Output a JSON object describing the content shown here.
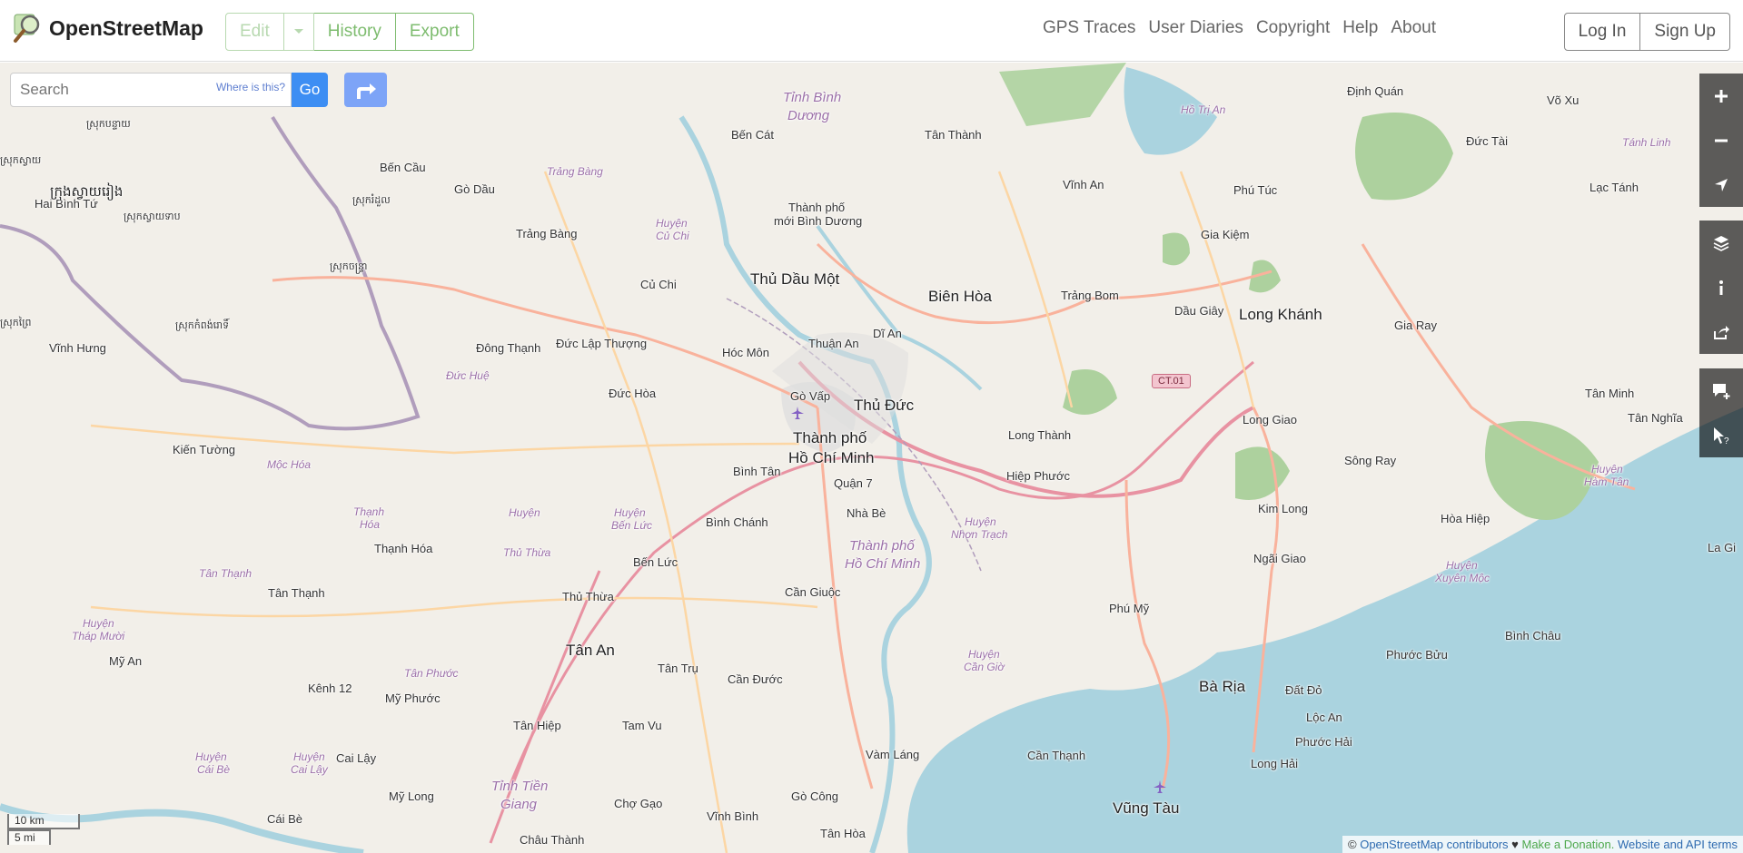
{
  "header": {
    "site_name": "OpenStreetMap",
    "edit_label": "Edit",
    "history_label": "History",
    "export_label": "Export",
    "nav": [
      "GPS Traces",
      "User Diaries",
      "Copyright",
      "Help",
      "About"
    ],
    "login_label": "Log In",
    "signup_label": "Sign Up"
  },
  "search": {
    "placeholder": "Search",
    "where_label": "Where is this?",
    "go_label": "Go"
  },
  "map_controls": [
    "zoom-in",
    "zoom-out",
    "show-my-location",
    "layers",
    "map-key",
    "share",
    "add-note",
    "query-features"
  ],
  "scale": {
    "metric": "10 km",
    "imperial": "5 mi"
  },
  "attribution": {
    "prefix": "© ",
    "contributors": "OpenStreetMap contributors",
    "heart": " ♥ ",
    "donate": "Make a Donation.",
    "terms": " Website and API terms"
  },
  "places": [
    {
      "name": "Thành phố",
      "cls": "big"
    },
    {
      "name": "Hồ Chí Minh",
      "cls": "big"
    },
    {
      "name": "Thủ Đức",
      "cls": "big"
    },
    {
      "name": "Biên Hòa",
      "cls": "big"
    },
    {
      "name": "Thủ Dầu Một",
      "cls": "big"
    },
    {
      "name": "Long Khánh",
      "cls": "big"
    },
    {
      "name": "Tân An",
      "cls": "big"
    },
    {
      "name": "Bà Rịa",
      "cls": "big"
    },
    {
      "name": "Vũng Tàu",
      "cls": "big"
    },
    {
      "name": "Gò Vấp",
      "cls": ""
    },
    {
      "name": "Hóc Môn",
      "cls": ""
    },
    {
      "name": "Thuận An",
      "cls": ""
    },
    {
      "name": "Dĩ An",
      "cls": ""
    },
    {
      "name": "Bình Tân",
      "cls": ""
    },
    {
      "name": "Quận 7",
      "cls": ""
    },
    {
      "name": "Nhà Bè",
      "cls": ""
    },
    {
      "name": "Bình Chánh",
      "cls": ""
    },
    {
      "name": "Bến Lức",
      "cls": ""
    },
    {
      "name": "Cần Giuộc",
      "cls": ""
    },
    {
      "name": "Thủ Thừa",
      "cls": ""
    },
    {
      "name": "Cần Đước",
      "cls": ""
    },
    {
      "name": "Tân Trụ",
      "cls": ""
    },
    {
      "name": "Long Thành",
      "cls": ""
    },
    {
      "name": "Hiệp Phước",
      "cls": ""
    },
    {
      "name": "Trảng Bom",
      "cls": ""
    },
    {
      "name": "Dầu Giây",
      "cls": ""
    },
    {
      "name": "Gia Kiệm",
      "cls": ""
    },
    {
      "name": "Vĩnh An",
      "cls": ""
    },
    {
      "name": "Phú Túc",
      "cls": ""
    },
    {
      "name": "Tân Thành",
      "cls": ""
    },
    {
      "name": "Bến Cát",
      "cls": ""
    },
    {
      "name": "Thành phố",
      "cls": ""
    },
    {
      "name": "mới Bình Dương",
      "cls": ""
    },
    {
      "name": "Củ Chi",
      "cls": ""
    },
    {
      "name": "Trảng Bàng",
      "cls": ""
    },
    {
      "name": "Gò Dầu",
      "cls": ""
    },
    {
      "name": "Bến Cầu",
      "cls": ""
    },
    {
      "name": "Đức Lập Thượng",
      "cls": ""
    },
    {
      "name": "Đông Thạnh",
      "cls": ""
    },
    {
      "name": "Đức Hòa",
      "cls": ""
    },
    {
      "name": "Hai Bình Tứ",
      "cls": ""
    },
    {
      "name": "Vĩnh Hưng",
      "cls": ""
    },
    {
      "name": "Kiến Tường",
      "cls": ""
    },
    {
      "name": "Thạnh Hóa",
      "cls": ""
    },
    {
      "name": "Tân Thạnh",
      "cls": ""
    },
    {
      "name": "Mỹ An",
      "cls": ""
    },
    {
      "name": "Kênh 12",
      "cls": ""
    },
    {
      "name": "Mỹ Phước",
      "cls": ""
    },
    {
      "name": "Cai Lậy",
      "cls": ""
    },
    {
      "name": "Mỹ Long",
      "cls": ""
    },
    {
      "name": "Cái Bè",
      "cls": ""
    },
    {
      "name": "Tân Hiệp",
      "cls": ""
    },
    {
      "name": "Tam Vu",
      "cls": ""
    },
    {
      "name": "Chợ Gạo",
      "cls": ""
    },
    {
      "name": "Vàm Láng",
      "cls": ""
    },
    {
      "name": "Gò Công",
      "cls": ""
    },
    {
      "name": "Vĩnh Bình",
      "cls": ""
    },
    {
      "name": "Châu Thành",
      "cls": ""
    },
    {
      "name": "Tân Hòa",
      "cls": ""
    },
    {
      "name": "Cần Thạnh",
      "cls": ""
    },
    {
      "name": "Phú Mỹ",
      "cls": ""
    },
    {
      "name": "Đất Đỏ",
      "cls": ""
    },
    {
      "name": "Lộc An",
      "cls": ""
    },
    {
      "name": "Phước Hải",
      "cls": ""
    },
    {
      "name": "Long Hải",
      "cls": ""
    },
    {
      "name": "Phước Bửu",
      "cls": ""
    },
    {
      "name": "Bình Châu",
      "cls": ""
    },
    {
      "name": "Ngãi Giao",
      "cls": ""
    },
    {
      "name": "Kim Long",
      "cls": ""
    },
    {
      "name": "Sông Ray",
      "cls": ""
    },
    {
      "name": "Long Giao",
      "cls": ""
    },
    {
      "name": "Gia Ray",
      "cls": ""
    },
    {
      "name": "Hòa Hiệp",
      "cls": ""
    },
    {
      "name": "Tân Minh",
      "cls": ""
    },
    {
      "name": "Tân Nghĩa",
      "cls": ""
    },
    {
      "name": "Lạc Tánh",
      "cls": ""
    },
    {
      "name": "Đức Tài",
      "cls": ""
    },
    {
      "name": "Võ Xu",
      "cls": ""
    },
    {
      "name": "Định Quán",
      "cls": ""
    },
    {
      "name": "La Gi",
      "cls": ""
    },
    {
      "name": "Tỉnh Bình",
      "cls": "area"
    },
    {
      "name": "Dương",
      "cls": "area"
    },
    {
      "name": "Hồ Trị An",
      "cls": "area"
    },
    {
      "name": "Tánh Linh",
      "cls": "area"
    },
    {
      "name": "Huyện",
      "cls": "area"
    },
    {
      "name": "Củ Chi",
      "cls": "area"
    },
    {
      "name": "Trảng Bàng",
      "cls": "area"
    },
    {
      "name": "Đức Huệ",
      "cls": "area"
    },
    {
      "name": "Mộc Hóa",
      "cls": "area"
    },
    {
      "name": "Thạnh",
      "cls": "area"
    },
    {
      "name": "Hóa",
      "cls": "area"
    },
    {
      "name": "Huyện",
      "cls": "area"
    },
    {
      "name": "Thủ Thừa",
      "cls": "area"
    },
    {
      "name": "Huyện",
      "cls": "area"
    },
    {
      "name": "Bến Lức",
      "cls": "area"
    },
    {
      "name": "Tân Thạnh",
      "cls": "area"
    },
    {
      "name": "Huyện",
      "cls": "area"
    },
    {
      "name": "Tháp Mười",
      "cls": "area"
    },
    {
      "name": "Tân Phước",
      "cls": "area"
    },
    {
      "name": "Huyện",
      "cls": "area"
    },
    {
      "name": "Cái Bè",
      "cls": "area"
    },
    {
      "name": "Huyện",
      "cls": "area"
    },
    {
      "name": "Cai Lậy",
      "cls": "area"
    },
    {
      "name": "Tỉnh Tiền",
      "cls": "area"
    },
    {
      "name": "Giang",
      "cls": "area"
    },
    {
      "name": "Thành phố",
      "cls": "area"
    },
    {
      "name": "Hồ Chí Minh",
      "cls": "area"
    },
    {
      "name": "Huyện",
      "cls": "area"
    },
    {
      "name": "Nhơn Trạch",
      "cls": "area"
    },
    {
      "name": "Huyện",
      "cls": "area"
    },
    {
      "name": "Cần Giờ",
      "cls": "area"
    },
    {
      "name": "Huyện",
      "cls": "area"
    },
    {
      "name": "Xuyên Mộc",
      "cls": "area"
    },
    {
      "name": "Huyện",
      "cls": "area"
    },
    {
      "name": "Hàm Tân",
      "cls": "area"
    },
    {
      "name": "ស្រុកបន្ទាយ",
      "cls": ""
    },
    {
      "name": "ស្រុកស្វាយ",
      "cls": ""
    },
    {
      "name": "ក្រុងស្វាយរៀង",
      "cls": "big"
    },
    {
      "name": "ស្រុកស្វាយទាប",
      "cls": ""
    },
    {
      "name": "ស្រុកចន្ទ្រា",
      "cls": ""
    },
    {
      "name": "ស្រុករំដួល",
      "cls": ""
    },
    {
      "name": "ស្រុកកំពង់រោទិ៍",
      "cls": ""
    },
    {
      "name": "ស្រុកព្រៃ",
      "cls": ""
    }
  ],
  "road_shield": "CT.01"
}
